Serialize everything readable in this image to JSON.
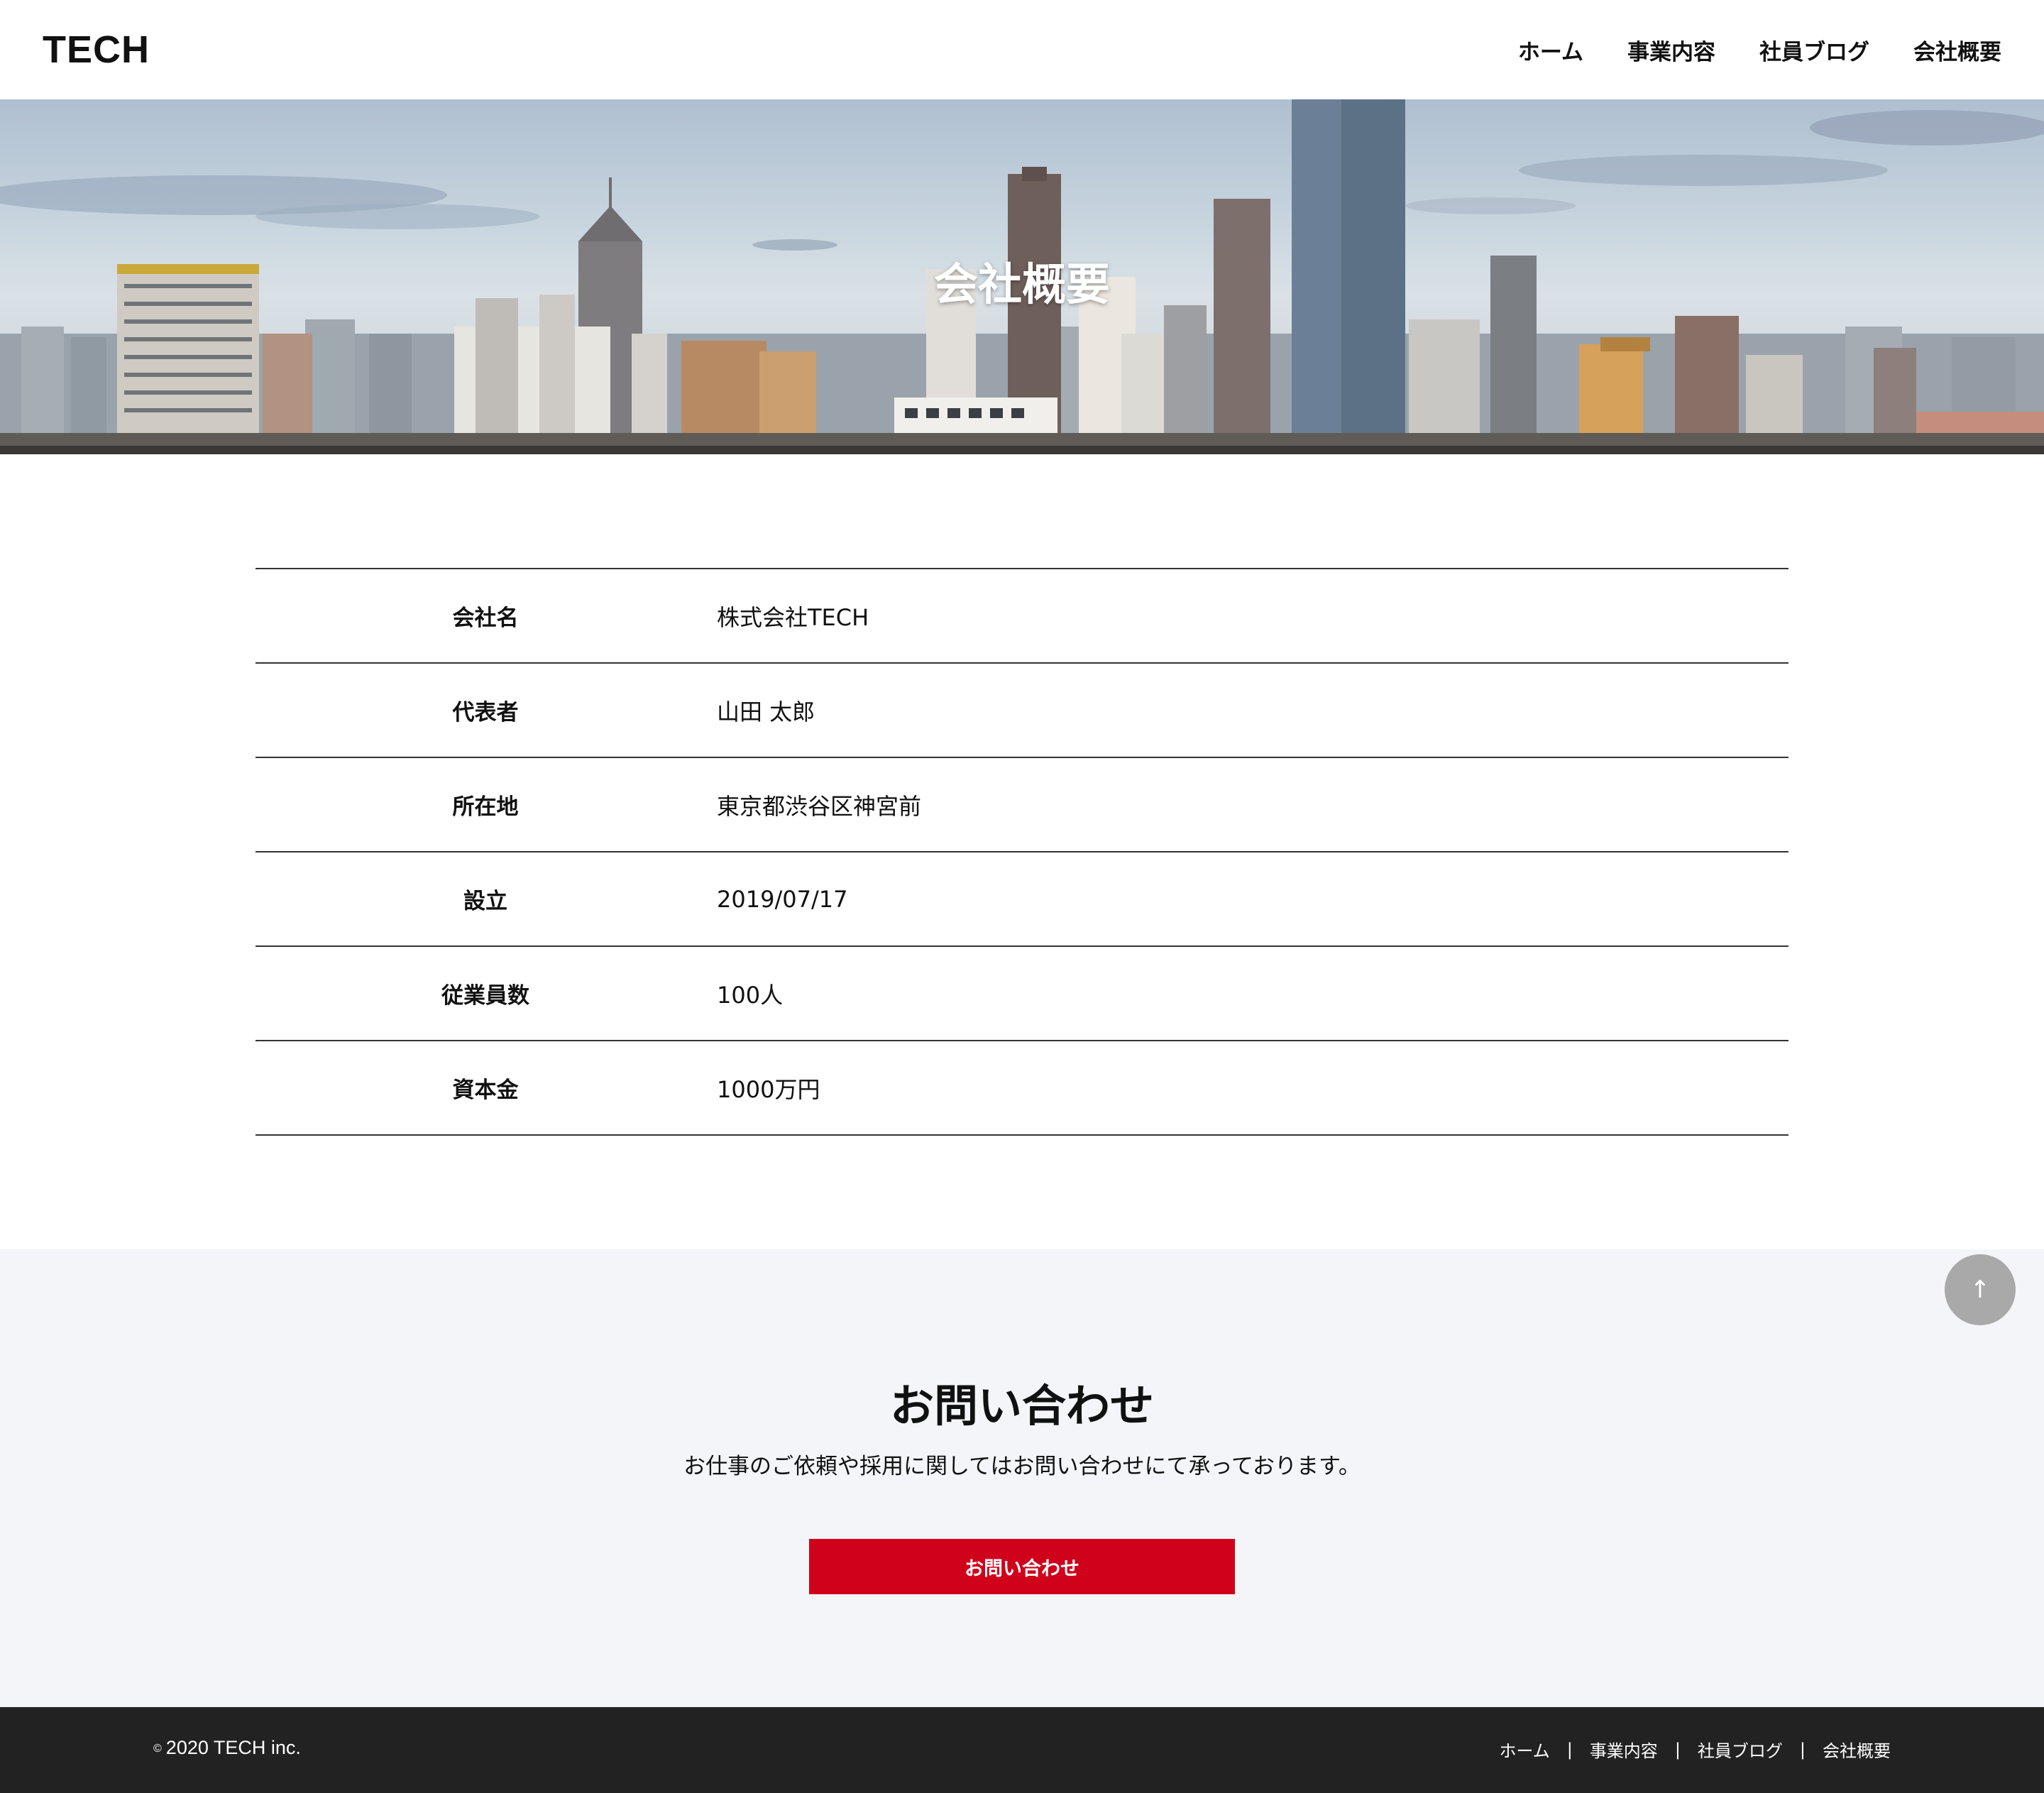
{
  "header": {
    "logo": "TECH",
    "nav": [
      "ホーム",
      "事業内容",
      "社員ブログ",
      "会社概要"
    ]
  },
  "hero": {
    "title": "会社概要"
  },
  "company": {
    "rows": [
      {
        "label": "会社名",
        "value": "株式会社TECH"
      },
      {
        "label": "代表者",
        "value": "山田 太郎"
      },
      {
        "label": "所在地",
        "value": "東京都渋谷区神宮前"
      },
      {
        "label": "設立",
        "value": "2019/07/17"
      },
      {
        "label": "従業員数",
        "value": "100人"
      },
      {
        "label": "資本金",
        "value": "1000万円"
      }
    ]
  },
  "contact": {
    "title": "お問い合わせ",
    "text": "お仕事のご依頼や採用に関してはお問い合わせにて承っております。",
    "button_label": "お問い合わせ",
    "button_color": "#d0021b"
  },
  "scroll_top": {
    "icon": "arrow-up-icon",
    "glyph": "↑"
  },
  "footer": {
    "copyright_symbol": "©",
    "copyright": "2020 TECH inc.",
    "nav": [
      "ホーム",
      "事業内容",
      "社員ブログ",
      "会社概要"
    ],
    "separator": "|"
  }
}
